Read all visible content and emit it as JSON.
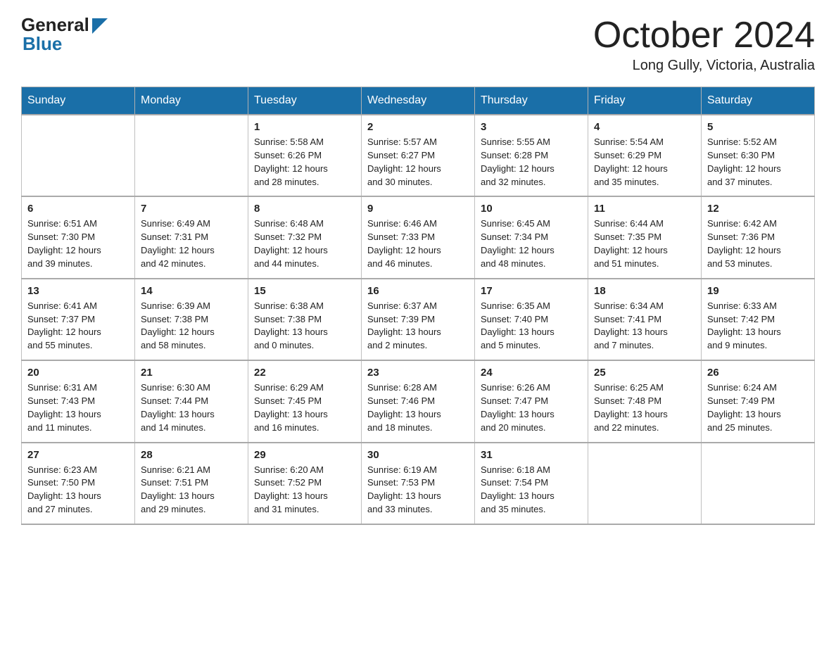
{
  "header": {
    "logo_general": "General",
    "logo_blue": "Blue",
    "month_title": "October 2024",
    "location": "Long Gully, Victoria, Australia"
  },
  "weekdays": [
    "Sunday",
    "Monday",
    "Tuesday",
    "Wednesday",
    "Thursday",
    "Friday",
    "Saturday"
  ],
  "weeks": [
    [
      {
        "day": "",
        "info": ""
      },
      {
        "day": "",
        "info": ""
      },
      {
        "day": "1",
        "info": "Sunrise: 5:58 AM\nSunset: 6:26 PM\nDaylight: 12 hours\nand 28 minutes."
      },
      {
        "day": "2",
        "info": "Sunrise: 5:57 AM\nSunset: 6:27 PM\nDaylight: 12 hours\nand 30 minutes."
      },
      {
        "day": "3",
        "info": "Sunrise: 5:55 AM\nSunset: 6:28 PM\nDaylight: 12 hours\nand 32 minutes."
      },
      {
        "day": "4",
        "info": "Sunrise: 5:54 AM\nSunset: 6:29 PM\nDaylight: 12 hours\nand 35 minutes."
      },
      {
        "day": "5",
        "info": "Sunrise: 5:52 AM\nSunset: 6:30 PM\nDaylight: 12 hours\nand 37 minutes."
      }
    ],
    [
      {
        "day": "6",
        "info": "Sunrise: 6:51 AM\nSunset: 7:30 PM\nDaylight: 12 hours\nand 39 minutes."
      },
      {
        "day": "7",
        "info": "Sunrise: 6:49 AM\nSunset: 7:31 PM\nDaylight: 12 hours\nand 42 minutes."
      },
      {
        "day": "8",
        "info": "Sunrise: 6:48 AM\nSunset: 7:32 PM\nDaylight: 12 hours\nand 44 minutes."
      },
      {
        "day": "9",
        "info": "Sunrise: 6:46 AM\nSunset: 7:33 PM\nDaylight: 12 hours\nand 46 minutes."
      },
      {
        "day": "10",
        "info": "Sunrise: 6:45 AM\nSunset: 7:34 PM\nDaylight: 12 hours\nand 48 minutes."
      },
      {
        "day": "11",
        "info": "Sunrise: 6:44 AM\nSunset: 7:35 PM\nDaylight: 12 hours\nand 51 minutes."
      },
      {
        "day": "12",
        "info": "Sunrise: 6:42 AM\nSunset: 7:36 PM\nDaylight: 12 hours\nand 53 minutes."
      }
    ],
    [
      {
        "day": "13",
        "info": "Sunrise: 6:41 AM\nSunset: 7:37 PM\nDaylight: 12 hours\nand 55 minutes."
      },
      {
        "day": "14",
        "info": "Sunrise: 6:39 AM\nSunset: 7:38 PM\nDaylight: 12 hours\nand 58 minutes."
      },
      {
        "day": "15",
        "info": "Sunrise: 6:38 AM\nSunset: 7:38 PM\nDaylight: 13 hours\nand 0 minutes."
      },
      {
        "day": "16",
        "info": "Sunrise: 6:37 AM\nSunset: 7:39 PM\nDaylight: 13 hours\nand 2 minutes."
      },
      {
        "day": "17",
        "info": "Sunrise: 6:35 AM\nSunset: 7:40 PM\nDaylight: 13 hours\nand 5 minutes."
      },
      {
        "day": "18",
        "info": "Sunrise: 6:34 AM\nSunset: 7:41 PM\nDaylight: 13 hours\nand 7 minutes."
      },
      {
        "day": "19",
        "info": "Sunrise: 6:33 AM\nSunset: 7:42 PM\nDaylight: 13 hours\nand 9 minutes."
      }
    ],
    [
      {
        "day": "20",
        "info": "Sunrise: 6:31 AM\nSunset: 7:43 PM\nDaylight: 13 hours\nand 11 minutes."
      },
      {
        "day": "21",
        "info": "Sunrise: 6:30 AM\nSunset: 7:44 PM\nDaylight: 13 hours\nand 14 minutes."
      },
      {
        "day": "22",
        "info": "Sunrise: 6:29 AM\nSunset: 7:45 PM\nDaylight: 13 hours\nand 16 minutes."
      },
      {
        "day": "23",
        "info": "Sunrise: 6:28 AM\nSunset: 7:46 PM\nDaylight: 13 hours\nand 18 minutes."
      },
      {
        "day": "24",
        "info": "Sunrise: 6:26 AM\nSunset: 7:47 PM\nDaylight: 13 hours\nand 20 minutes."
      },
      {
        "day": "25",
        "info": "Sunrise: 6:25 AM\nSunset: 7:48 PM\nDaylight: 13 hours\nand 22 minutes."
      },
      {
        "day": "26",
        "info": "Sunrise: 6:24 AM\nSunset: 7:49 PM\nDaylight: 13 hours\nand 25 minutes."
      }
    ],
    [
      {
        "day": "27",
        "info": "Sunrise: 6:23 AM\nSunset: 7:50 PM\nDaylight: 13 hours\nand 27 minutes."
      },
      {
        "day": "28",
        "info": "Sunrise: 6:21 AM\nSunset: 7:51 PM\nDaylight: 13 hours\nand 29 minutes."
      },
      {
        "day": "29",
        "info": "Sunrise: 6:20 AM\nSunset: 7:52 PM\nDaylight: 13 hours\nand 31 minutes."
      },
      {
        "day": "30",
        "info": "Sunrise: 6:19 AM\nSunset: 7:53 PM\nDaylight: 13 hours\nand 33 minutes."
      },
      {
        "day": "31",
        "info": "Sunrise: 6:18 AM\nSunset: 7:54 PM\nDaylight: 13 hours\nand 35 minutes."
      },
      {
        "day": "",
        "info": ""
      },
      {
        "day": "",
        "info": ""
      }
    ]
  ]
}
